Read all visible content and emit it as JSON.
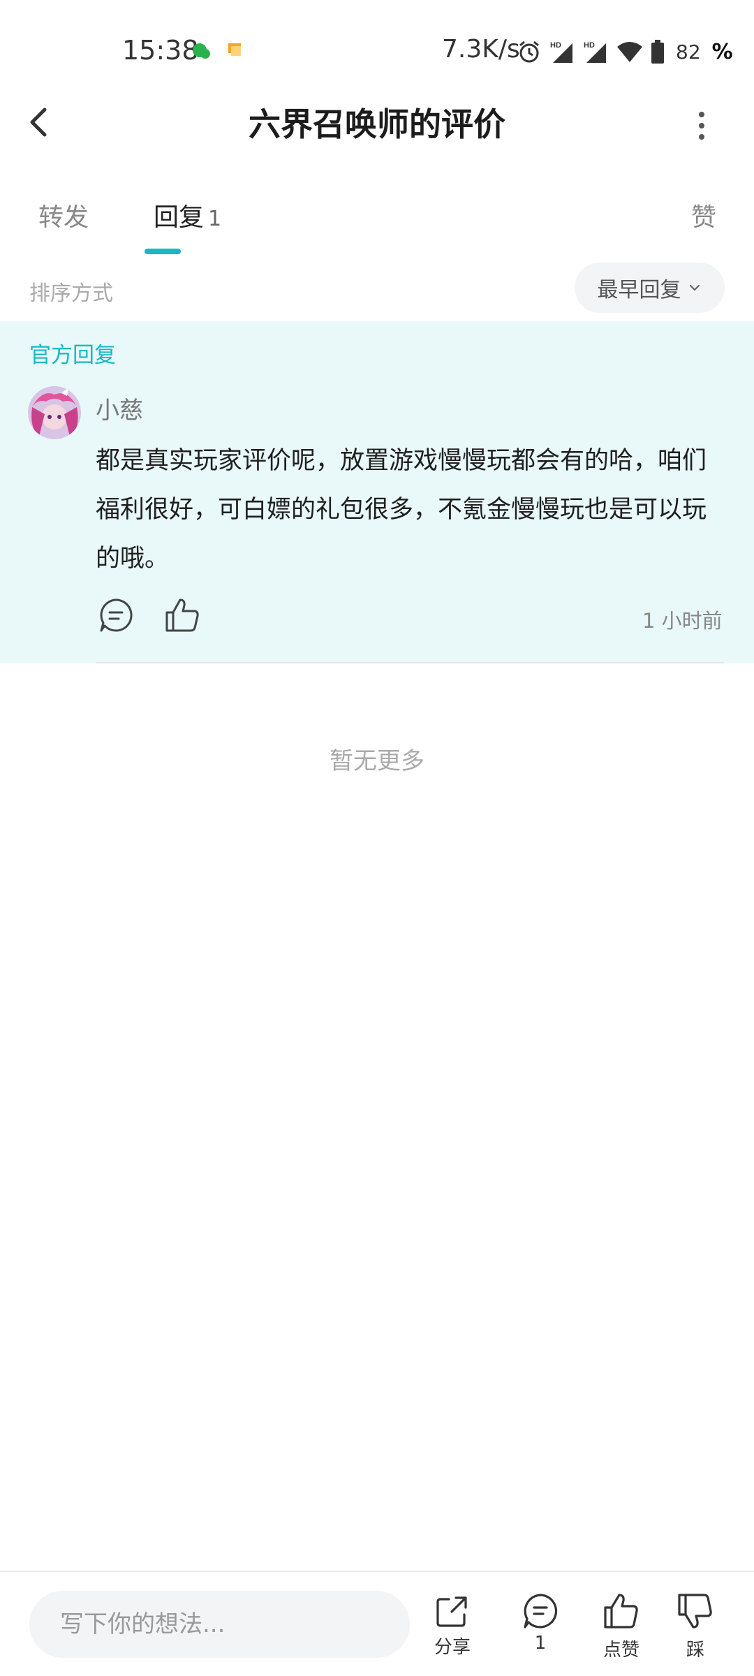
{
  "status_bar": {
    "time": "15:38",
    "speed": "7.3K/s",
    "battery": "82",
    "battery_pct_symbol": "%"
  },
  "header": {
    "title": "六界召唤师的评价"
  },
  "tabs": {
    "forward": "转发",
    "replies": "回复",
    "replies_count": "1",
    "likes": "赞"
  },
  "sort": {
    "label": "排序方式",
    "selected": "最早回复"
  },
  "official_reply": {
    "badge": "官方回复",
    "author": "小慈",
    "text": "都是真实玩家评价呢，放置游戏慢慢玩都会有的哈，咱们福利很好，可白嫖的礼包很多，不氪金慢慢玩也是可以玩的哦。",
    "time": "1 小时前"
  },
  "list_end": "暂无更多",
  "bottom_bar": {
    "input_placeholder": "写下你的想法...",
    "share_label": "分享",
    "comment_count": "1",
    "like_label": "点赞",
    "dislike_label": "踩"
  },
  "colors": {
    "accent": "#15b8c3",
    "card_bg": "#e9f8f9"
  }
}
